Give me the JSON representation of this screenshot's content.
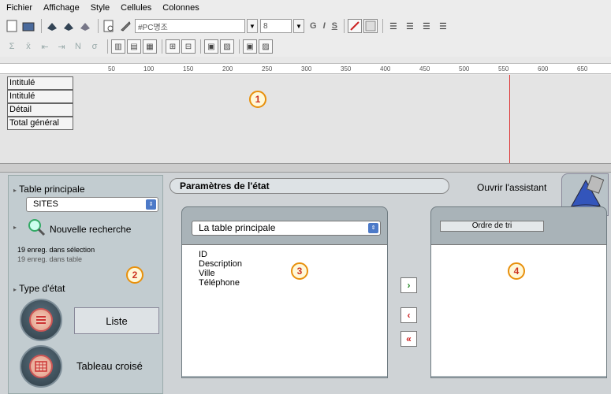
{
  "menu": [
    "Fichier",
    "Affichage",
    "Style",
    "Cellules",
    "Colonnes"
  ],
  "toolbar": {
    "font_name": "#PC명조",
    "font_size": "8",
    "bold_label": "G",
    "italic_label": "I",
    "underline_label": "S"
  },
  "ruler": {
    "ticks": [
      "50",
      "100",
      "150",
      "200",
      "250",
      "300",
      "350",
      "400",
      "450",
      "500",
      "550",
      "600",
      "650"
    ]
  },
  "preview": {
    "sections": [
      "Intitulé",
      "Intitulé",
      "Détail",
      "Total général"
    ]
  },
  "badges": [
    "1",
    "2",
    "3",
    "4"
  ],
  "left_panel": {
    "table_label": "Table principale",
    "table_value": "SITES",
    "search_label": "Nouvelle recherche",
    "selection_count": "19 enreg. dans sélection",
    "table_count": "19 enreg. dans table",
    "type_label": "Type d'état",
    "type_list": "Liste",
    "type_cross": "Tableau croisé"
  },
  "params": {
    "header": "Paramètres de l'état",
    "assistant": "Ouvrir l'assistant",
    "table_select": "La table principale",
    "fields": [
      "ID",
      "Description",
      "Ville",
      "Téléphone"
    ],
    "sort_order": "Ordre de tri"
  },
  "colors": {
    "badge_border": "#e8900c",
    "badge_text": "#c32",
    "select_arrow": "#4d7ac8",
    "guide_line": "#d33"
  }
}
